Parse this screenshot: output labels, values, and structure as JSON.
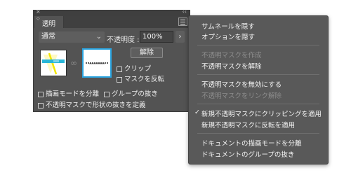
{
  "panel": {
    "close_glyph": "×",
    "collapse_glyph": "‹‹",
    "tab_arrows": "◇",
    "tab_label": "透明",
    "blend_mode": "通常",
    "blend_chevron": "⌄",
    "opacity_label": "不透明度 :",
    "opacity_value": "100%",
    "opacity_arrow": "›",
    "link_glyph": "∞",
    "release_button": "解除",
    "clip_label": "クリップ",
    "invert_label": "マスクを反転",
    "isolate_label": "描画モードを分離",
    "knockout_label": "グループの抜き",
    "define_label": "不透明マスクで形状の抜きを定義"
  },
  "menu": {
    "check_glyph": "✓",
    "items": [
      {
        "label": "サムネールを隠す",
        "enabled": true
      },
      {
        "label": "オプションを隠す",
        "enabled": true
      },
      {
        "label": "不透明マスクを作成",
        "enabled": false
      },
      {
        "label": "不透明マスクを解除",
        "enabled": true
      },
      {
        "label": "不透明マスクを無効にする",
        "enabled": true
      },
      {
        "label": "不透明マスクをリンク解除",
        "enabled": false
      },
      {
        "label": "新規不透明マスクにクリッピングを適用",
        "enabled": true,
        "checked": true
      },
      {
        "label": "新規不透明マスクに反転を適用",
        "enabled": true
      },
      {
        "label": "ドキュメントの描画モードを分離",
        "enabled": true
      },
      {
        "label": "ドキュメントのグループの抜き",
        "enabled": true
      }
    ]
  },
  "colors": {
    "panel_bg": "#535353",
    "menu_bg": "#595959",
    "mask_highlight": "#2aa4e0",
    "art_yellow": "#f2e600",
    "art_cyan": "#29b6d8"
  }
}
